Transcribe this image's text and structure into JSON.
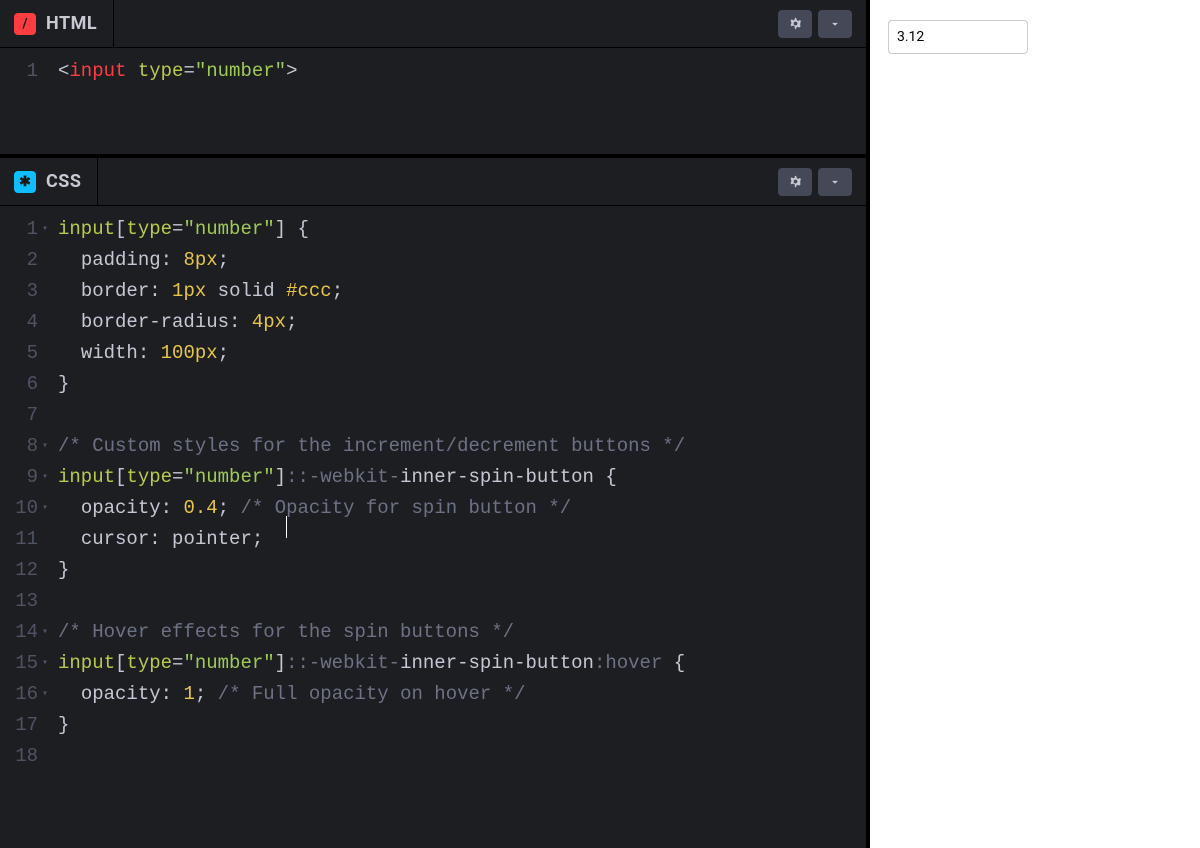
{
  "panes": {
    "html": {
      "label": "HTML",
      "badge": "/"
    },
    "css": {
      "label": "CSS",
      "badge": "✱"
    }
  },
  "preview": {
    "value": "3.12"
  },
  "html_code": {
    "lines": [
      "1"
    ],
    "rows": [
      [
        {
          "c": "punct",
          "t": "<"
        },
        {
          "c": "tag",
          "t": "input"
        },
        {
          "c": "punct",
          "t": " "
        },
        {
          "c": "attr",
          "t": "type"
        },
        {
          "c": "punct",
          "t": "="
        },
        {
          "c": "string",
          "t": "\"number\""
        },
        {
          "c": "punct",
          "t": ">"
        }
      ]
    ]
  },
  "css_code": {
    "lines": [
      "1",
      "2",
      "3",
      "4",
      "5",
      "6",
      "7",
      "8",
      "9",
      "10",
      "11",
      "12",
      "13",
      "14",
      "15",
      "16",
      "17",
      "18"
    ],
    "folds": [
      1,
      8,
      9,
      10,
      14,
      15,
      16
    ],
    "rows": [
      [
        {
          "c": "sel",
          "t": "input"
        },
        {
          "c": "punct",
          "t": "["
        },
        {
          "c": "sel",
          "t": "type"
        },
        {
          "c": "punct",
          "t": "="
        },
        {
          "c": "string",
          "t": "\"number\""
        },
        {
          "c": "punct",
          "t": "]"
        },
        {
          "c": "punct",
          "t": " {"
        }
      ],
      [
        {
          "c": "punct",
          "t": "  "
        },
        {
          "c": "prop",
          "t": "padding"
        },
        {
          "c": "punct",
          "t": ": "
        },
        {
          "c": "num",
          "t": "8px"
        },
        {
          "c": "punct",
          "t": ";"
        }
      ],
      [
        {
          "c": "punct",
          "t": "  "
        },
        {
          "c": "prop",
          "t": "border"
        },
        {
          "c": "punct",
          "t": ": "
        },
        {
          "c": "num",
          "t": "1px"
        },
        {
          "c": "punct",
          "t": " "
        },
        {
          "c": "kw",
          "t": "solid"
        },
        {
          "c": "punct",
          "t": " "
        },
        {
          "c": "hex",
          "t": "#ccc"
        },
        {
          "c": "punct",
          "t": ";"
        }
      ],
      [
        {
          "c": "punct",
          "t": "  "
        },
        {
          "c": "prop",
          "t": "border-radius"
        },
        {
          "c": "punct",
          "t": ": "
        },
        {
          "c": "num",
          "t": "4px"
        },
        {
          "c": "punct",
          "t": ";"
        }
      ],
      [
        {
          "c": "punct",
          "t": "  "
        },
        {
          "c": "prop",
          "t": "width"
        },
        {
          "c": "punct",
          "t": ": "
        },
        {
          "c": "num",
          "t": "100px"
        },
        {
          "c": "punct",
          "t": ";"
        }
      ],
      [
        {
          "c": "punct",
          "t": "}"
        }
      ],
      [],
      [
        {
          "c": "comment",
          "t": "/* Custom styles for the increment/decrement buttons */"
        }
      ],
      [
        {
          "c": "sel",
          "t": "input"
        },
        {
          "c": "punct",
          "t": "["
        },
        {
          "c": "sel",
          "t": "type"
        },
        {
          "c": "punct",
          "t": "="
        },
        {
          "c": "string",
          "t": "\"number\""
        },
        {
          "c": "punct",
          "t": "]"
        },
        {
          "c": "pseudo",
          "t": "::-webkit-"
        },
        {
          "c": "pseudo2",
          "t": "inner-spin-button"
        },
        {
          "c": "punct",
          "t": " {"
        }
      ],
      [
        {
          "c": "punct",
          "t": "  "
        },
        {
          "c": "prop",
          "t": "opacity"
        },
        {
          "c": "punct",
          "t": ": "
        },
        {
          "c": "num",
          "t": "0.4"
        },
        {
          "c": "punct",
          "t": "; "
        },
        {
          "c": "comment",
          "t": "/* O"
        },
        {
          "cursor": true
        },
        {
          "c": "comment",
          "t": "pacity for spin button */"
        }
      ],
      [
        {
          "c": "punct",
          "t": "  "
        },
        {
          "c": "prop",
          "t": "cursor"
        },
        {
          "c": "punct",
          "t": ": "
        },
        {
          "c": "kw",
          "t": "pointer"
        },
        {
          "c": "punct",
          "t": ";"
        }
      ],
      [
        {
          "c": "punct",
          "t": "}"
        }
      ],
      [],
      [
        {
          "c": "comment",
          "t": "/* Hover effects for the spin buttons */"
        }
      ],
      [
        {
          "c": "sel",
          "t": "input"
        },
        {
          "c": "punct",
          "t": "["
        },
        {
          "c": "sel",
          "t": "type"
        },
        {
          "c": "punct",
          "t": "="
        },
        {
          "c": "string",
          "t": "\"number\""
        },
        {
          "c": "punct",
          "t": "]"
        },
        {
          "c": "pseudo",
          "t": "::-webkit-"
        },
        {
          "c": "pseudo2",
          "t": "inner-spin-button"
        },
        {
          "c": "pseudo",
          "t": ":hover"
        },
        {
          "c": "punct",
          "t": " {"
        }
      ],
      [
        {
          "c": "punct",
          "t": "  "
        },
        {
          "c": "prop",
          "t": "opacity"
        },
        {
          "c": "punct",
          "t": ": "
        },
        {
          "c": "num",
          "t": "1"
        },
        {
          "c": "punct",
          "t": "; "
        },
        {
          "c": "comment",
          "t": "/* Full opacity on hover */"
        }
      ],
      [
        {
          "c": "punct",
          "t": "}"
        }
      ],
      []
    ]
  }
}
